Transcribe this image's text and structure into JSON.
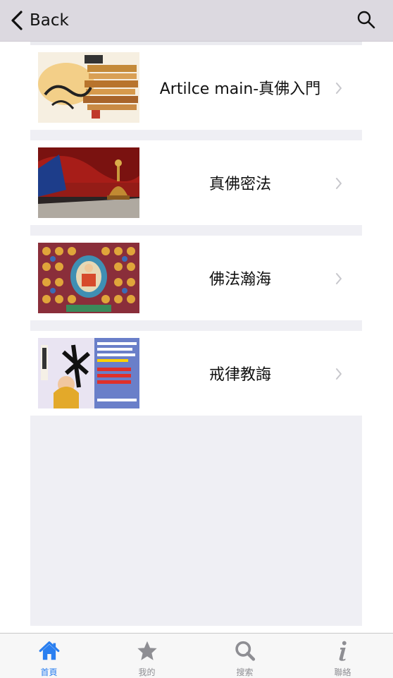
{
  "nav": {
    "back_label": "Back",
    "back_icon": "chevron-left-icon",
    "search_icon": "search-icon"
  },
  "list": {
    "items": [
      {
        "title": "Artilce main-真佛入門",
        "thumb": "book-calligraphy-thumbnail"
      },
      {
        "title": "真佛密法",
        "thumb": "vajra-bell-thumbnail"
      },
      {
        "title": "佛法瀚海",
        "thumb": "thangka-mandala-thumbnail"
      },
      {
        "title": "戒律教誨",
        "thumb": "precepts-poster-thumbnail"
      }
    ]
  },
  "tabbar": {
    "tabs": [
      {
        "label": "首頁",
        "icon": "home-icon",
        "active": true
      },
      {
        "label": "我的",
        "icon": "star-icon",
        "active": false
      },
      {
        "label": "搜索",
        "icon": "search-icon",
        "active": false
      },
      {
        "label": "聯絡",
        "icon": "info-icon",
        "active": false
      }
    ]
  },
  "colors": {
    "nav_bg": "#dcd9e0",
    "list_bg": "#efeff4",
    "tab_active": "#2a7ff0",
    "tab_inactive": "#8e8e93"
  }
}
